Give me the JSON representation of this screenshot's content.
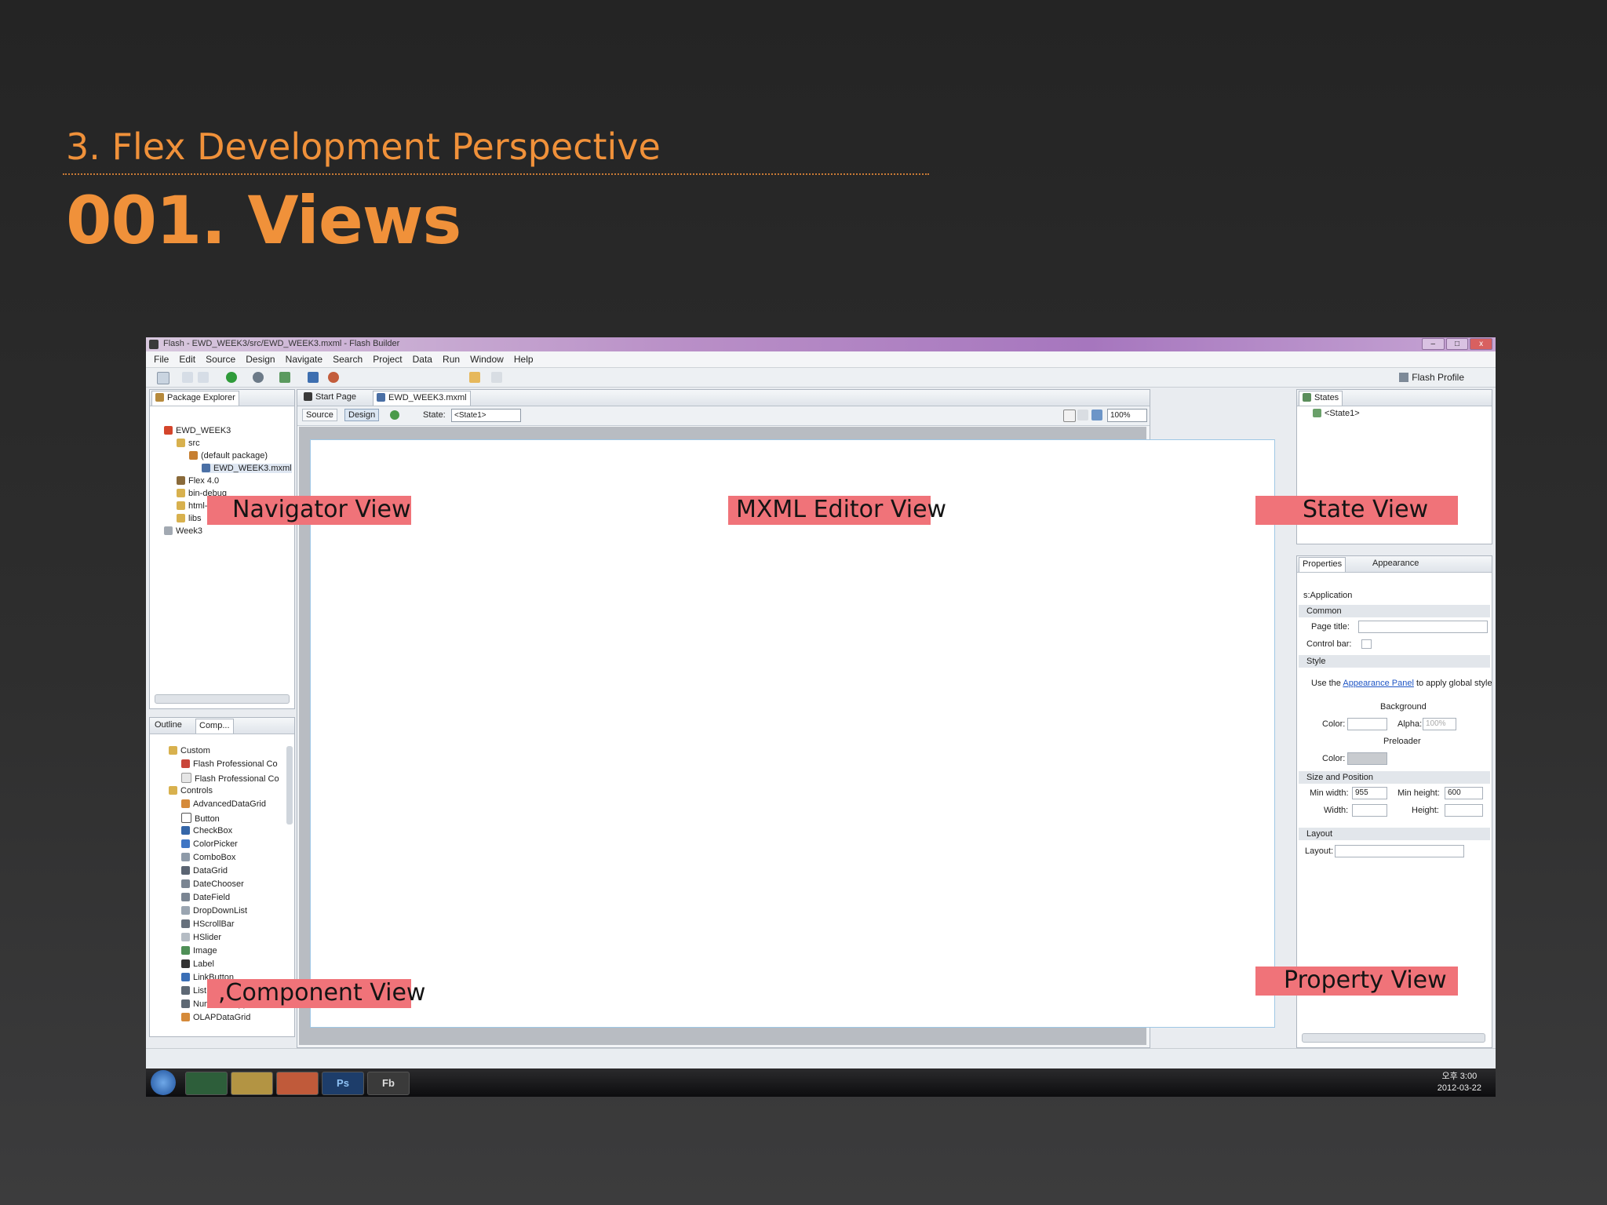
{
  "slide": {
    "subtitle": "3. Flex Development Perspective",
    "title": "001. Views"
  },
  "window": {
    "title": "Flash - EWD_WEEK3/src/EWD_WEEK3.mxml - Flash Builder",
    "min": "–",
    "max": "□",
    "close": "x",
    "menu": [
      "File",
      "Edit",
      "Source",
      "Design",
      "Navigate",
      "Search",
      "Project",
      "Data",
      "Run",
      "Window",
      "Help"
    ],
    "perspective": "Flash Profile"
  },
  "package_explorer": {
    "tab": "Package Explorer",
    "tree": [
      "EWD_WEEK3",
      "src",
      "(default package)",
      "EWD_WEEK3.mxml",
      "Flex 4.0",
      "bin-debug",
      "html-template",
      "libs",
      "Week3"
    ]
  },
  "outline": {
    "tab_outline": "Outline",
    "tab_components": "Comp...",
    "items": [
      "Custom",
      "Flash Professional Co",
      "Flash Professional Co",
      "Controls",
      "AdvancedDataGrid",
      "Button",
      "CheckBox",
      "ColorPicker",
      "ComboBox",
      "DataGrid",
      "DateChooser",
      "DateField",
      "DropDownList",
      "HScrollBar",
      "HSlider",
      "Image",
      "Label",
      "LinkButton",
      "List",
      "NumericStepper",
      "OLAPDataGrid"
    ]
  },
  "editor": {
    "tab_start": "Start Page",
    "tab_file": "EWD_WEEK3.mxml",
    "source": "Source",
    "design": "Design",
    "state_label": "State:",
    "state_value": "<State1>",
    "zoom": "100%"
  },
  "states": {
    "tab": "States",
    "item": "<State1>"
  },
  "properties": {
    "tab_properties": "Properties",
    "tab_appearance": "Appearance",
    "component": "s:Application",
    "common": "Common",
    "page_title": "Page title:",
    "control_bar": "Control bar:",
    "style": "Style",
    "use_the": "Use the",
    "appearance_link": "Appearance Panel",
    "apply_text": "to apply global styles",
    "background": "Background",
    "color": "Color:",
    "alpha": "Alpha:",
    "alpha_value": "100%",
    "preloader": "Preloader",
    "size_position": "Size and Position",
    "min_width": "Min width:",
    "min_width_value": "955",
    "min_height": "Min height:",
    "min_height_value": "600",
    "width": "Width:",
    "height": "Height:",
    "layout_section": "Layout",
    "layout": "Layout:"
  },
  "labels": {
    "navigator": "Navigator View",
    "editor": "MXML Editor View",
    "state": "State View",
    "component": ",Component View",
    "property": "Property View"
  },
  "taskbar": {
    "apps": [
      "Ps",
      "Fb"
    ],
    "time": "오후 3:00",
    "date": "2012-03-22"
  },
  "colors": {
    "accent": "#f0913a",
    "label_bg": "#f07379"
  }
}
